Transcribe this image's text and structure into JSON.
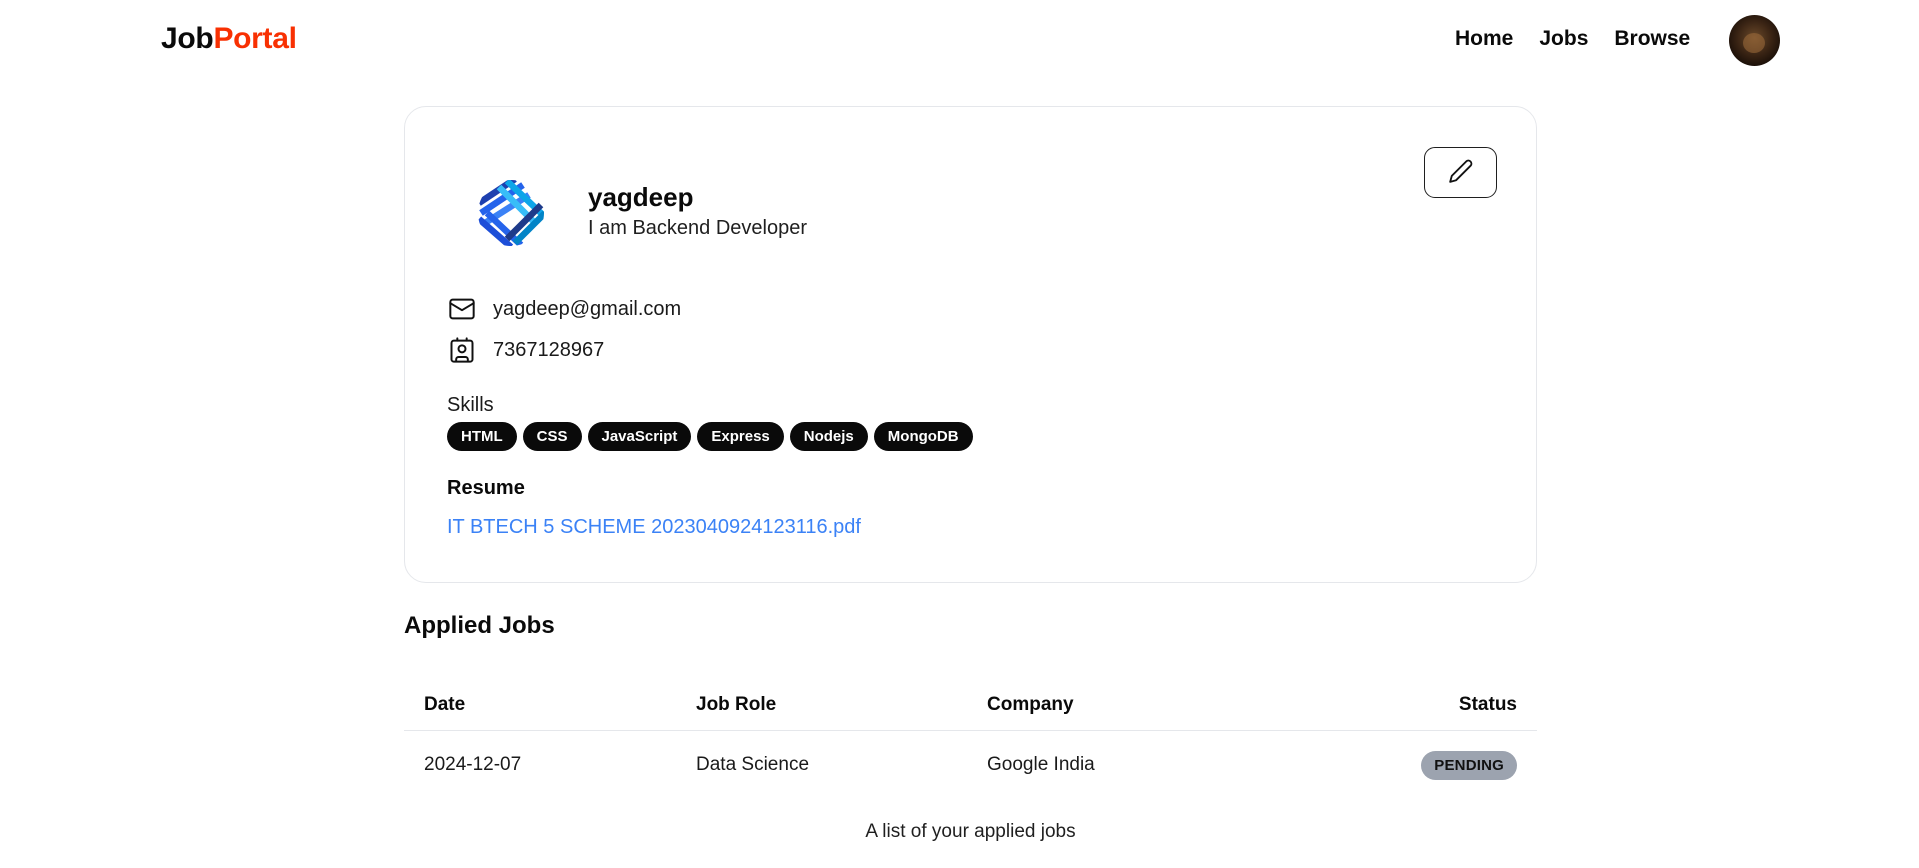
{
  "nav": {
    "logo_prefix": "Job",
    "logo_accent": "Portal",
    "links": [
      "Home",
      "Jobs",
      "Browse"
    ],
    "accent_color": "#f83002"
  },
  "profile": {
    "name": "yagdeep",
    "bio": "I am Backend Developer",
    "email": "yagdeep@gmail.com",
    "phone": "7367128967",
    "skills_label": "Skills",
    "skills": [
      "HTML",
      "CSS",
      "JavaScript",
      "Express",
      "Nodejs",
      "MongoDB"
    ],
    "resume_label": "Resume",
    "resume_file": "IT BTECH 5 SCHEME 2023040924123116.pdf",
    "icons": {
      "email": "mail-icon",
      "phone": "contact-card-icon",
      "edit": "pencil-icon"
    }
  },
  "applied_jobs": {
    "title": "Applied Jobs",
    "columns": [
      "Date",
      "Job Role",
      "Company",
      "Status"
    ],
    "rows": [
      {
        "date": "2024-12-07",
        "role": "Data Science",
        "company": "Google India",
        "status": "PENDING"
      }
    ],
    "caption": "A list of your applied jobs",
    "status_color": "#9ca3af"
  }
}
